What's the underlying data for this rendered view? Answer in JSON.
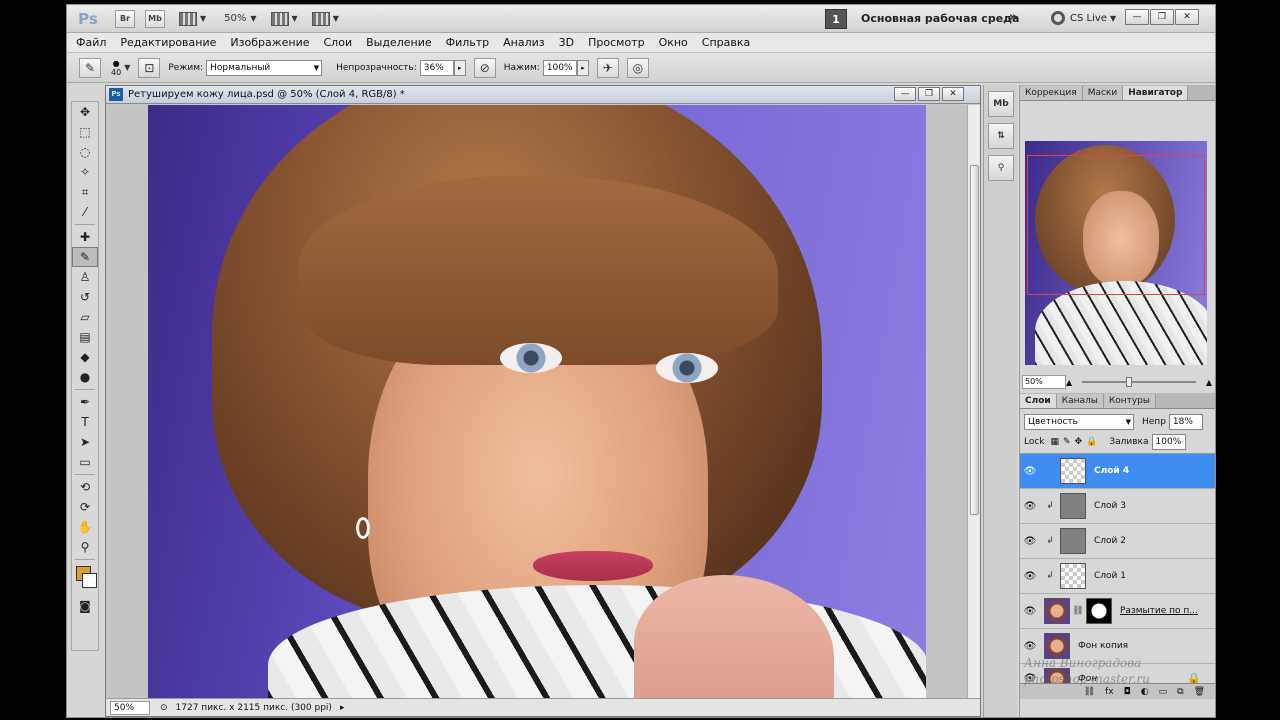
{
  "titlebar": {
    "logo": "Ps",
    "bridge": "Br",
    "minibridge": "Mb",
    "zoom": "50%",
    "workspace_number": "1",
    "workspace_name": "Основная рабочая среда",
    "more": "»",
    "cslive": "CS Live"
  },
  "menu": [
    "Файл",
    "Редактирование",
    "Изображение",
    "Слои",
    "Выделение",
    "Фильтр",
    "Анализ",
    "3D",
    "Просмотр",
    "Окно",
    "Справка"
  ],
  "options": {
    "brush_size": "40",
    "mode_label": "Режим:",
    "mode_value": "Нормальный",
    "opacity_label": "Непрозрачность:",
    "opacity_value": "36%",
    "pressure_label": "Нажим:",
    "pressure_value": "100%"
  },
  "document": {
    "icon": "Ps",
    "title": "Ретушируем кожу лица.psd @ 50% (Слой 4, RGB/8) *",
    "zoom": "50%",
    "info": "1727 пикс. x 2115 пикс. (300 ppi)"
  },
  "navigator": {
    "tabs": [
      "Коррекция",
      "Маски",
      "Навигатор"
    ],
    "active_tab": "Навигатор",
    "zoom": "50%"
  },
  "layers": {
    "tabs": [
      "Слои",
      "Каналы",
      "Контуры"
    ],
    "blend_mode": "Цветность",
    "opacity_label": "Непр",
    "opacity_value": "18%",
    "lock_label": "Lock",
    "fill_label": "Заливка",
    "fill_value": "100%",
    "items": [
      {
        "name": "Слой 4",
        "selected": true
      },
      {
        "name": "Слой 3",
        "selected": false
      },
      {
        "name": "Слой 2",
        "selected": false
      },
      {
        "name": "Слой 1",
        "selected": false
      },
      {
        "name": "Размытие по п...",
        "selected": false
      },
      {
        "name": "Фон копия",
        "selected": false
      },
      {
        "name": "Фон",
        "selected": false
      }
    ]
  },
  "watermark": {
    "line1": "Анна Виноградова",
    "line2": "photoshop-master.ru"
  }
}
